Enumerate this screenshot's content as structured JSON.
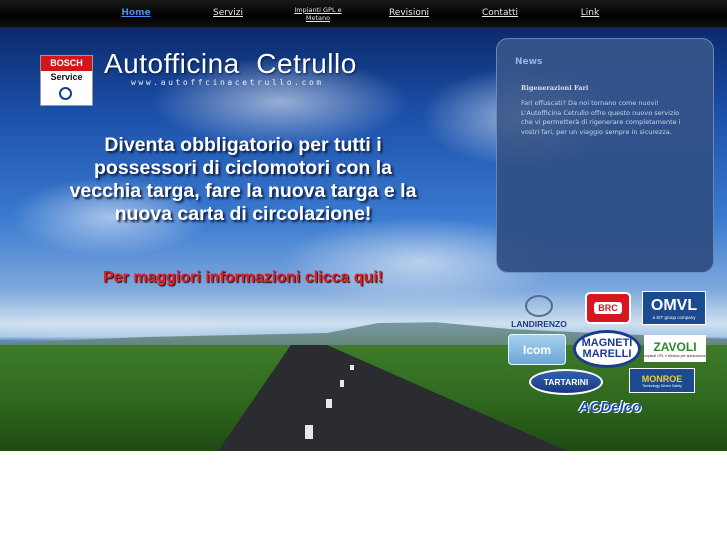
{
  "nav": {
    "items": [
      {
        "label": "Home",
        "active": true
      },
      {
        "label": "Servizi"
      },
      {
        "label": "Impianti GPL e Metano"
      },
      {
        "label": "Revisioni"
      },
      {
        "label": "Contatti"
      },
      {
        "label": "Link"
      }
    ]
  },
  "header": {
    "badge_top": "BOSCH",
    "badge_bottom": "Service",
    "title": "Autofficina  Cetrullo",
    "url": "www.autoffcinacetrullo.com"
  },
  "promo": {
    "text": "Diventa obbligatorio per tutti i possessori di ciclomotori con la vecchia targa, fare la nuova targa e la nuova carta di circolazione!",
    "link": "Per maggiori informazioni clicca qui!"
  },
  "news": {
    "title": "News",
    "item_title": "Rigenerazioni Fari",
    "item_body": "Fari offuscati? Da noi tornano come nuovi! L'Autofficina Cetrullo offre questo nuovo servizio che vi permetterà di rigenerare completamente i vostri fari, per un viaggio sempre in sicurezza."
  },
  "partners": {
    "landirenzo": "LANDIRENZO",
    "brc": "BRC",
    "omvl": "OMVL",
    "omvl_sub": "a SIT group company",
    "icom": "Icom",
    "magneti": "MAGNETI MARELLI",
    "zavoli": "ZAVOLI",
    "zavoli_sub": "impianti GPL e Metano per autotrazione",
    "tartarini": "TARTARINI",
    "monroe": "MONROE",
    "monroe_sub": "Technology Driven Safety",
    "acdelco": "ACDelco"
  },
  "colors": {
    "nav_bg": "#000000",
    "nav_active": "#4a8ee8",
    "promo_link": "#e02020",
    "bosch_red": "#d4151b"
  }
}
